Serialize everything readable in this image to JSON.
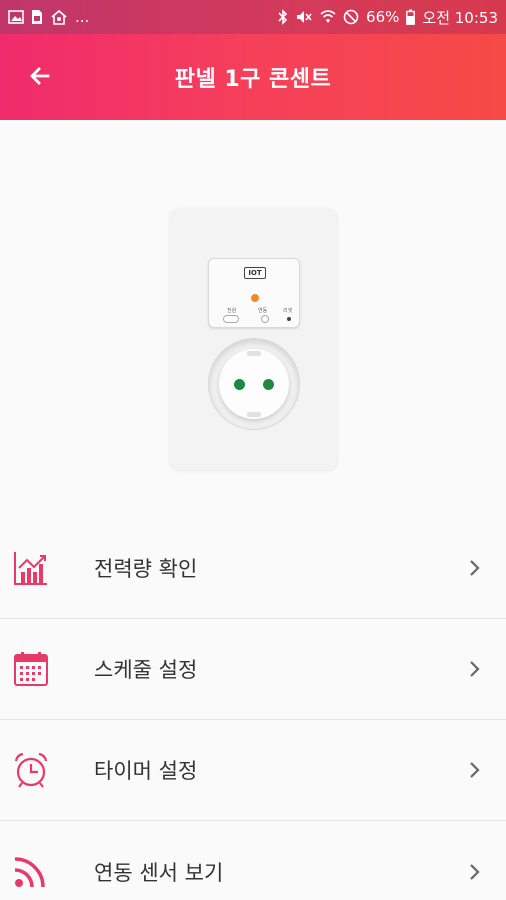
{
  "status_bar": {
    "battery": "66%",
    "time": "오전 10:53",
    "overflow": "...",
    "icons": [
      "image-icon",
      "sim-icon",
      "home-icon",
      "bluetooth-icon",
      "mute-icon",
      "wifi-icon",
      "dnd-icon",
      "battery-icon"
    ]
  },
  "app_bar": {
    "title": "판넬 1구 콘센트",
    "back_icon": "arrow-left-icon"
  },
  "device_image": {
    "module_label": "IOT",
    "button_labels": [
      "전원",
      "연동",
      "리셋"
    ]
  },
  "menu": [
    {
      "label": "전력량 확인",
      "icon": "chart-icon"
    },
    {
      "label": "스케줄 설정",
      "icon": "calendar-icon"
    },
    {
      "label": "타이머 설정",
      "icon": "alarm-clock-icon"
    },
    {
      "label": "연동 센서 보기",
      "icon": "signal-icon"
    }
  ],
  "colors": {
    "accent": "#e83a68",
    "gradient_start": "#f02b6c",
    "gradient_end": "#f64a45"
  }
}
